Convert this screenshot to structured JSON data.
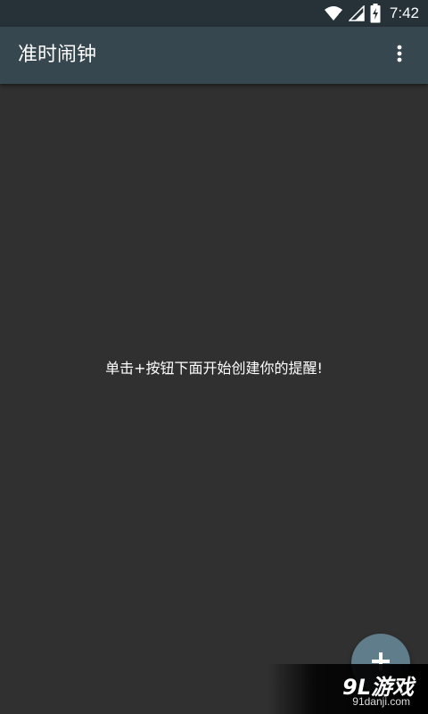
{
  "status_bar": {
    "time": "7:42",
    "icons": [
      "wifi-icon",
      "cell-signal-icon",
      "battery-charging-icon"
    ]
  },
  "app_bar": {
    "title": "准时闹钟",
    "menu_icon": "more-vert-icon"
  },
  "main": {
    "empty_message": "单击+按钮下面开始创建你的提醒!"
  },
  "fab": {
    "icon": "plus-icon"
  },
  "watermark": {
    "brand": "9L游戏",
    "url": "91danji.com"
  },
  "colors": {
    "background": "#303030",
    "status_bar": "#263138",
    "app_bar": "#37474f",
    "fab": "#607d8b",
    "text": "#ffffff"
  }
}
